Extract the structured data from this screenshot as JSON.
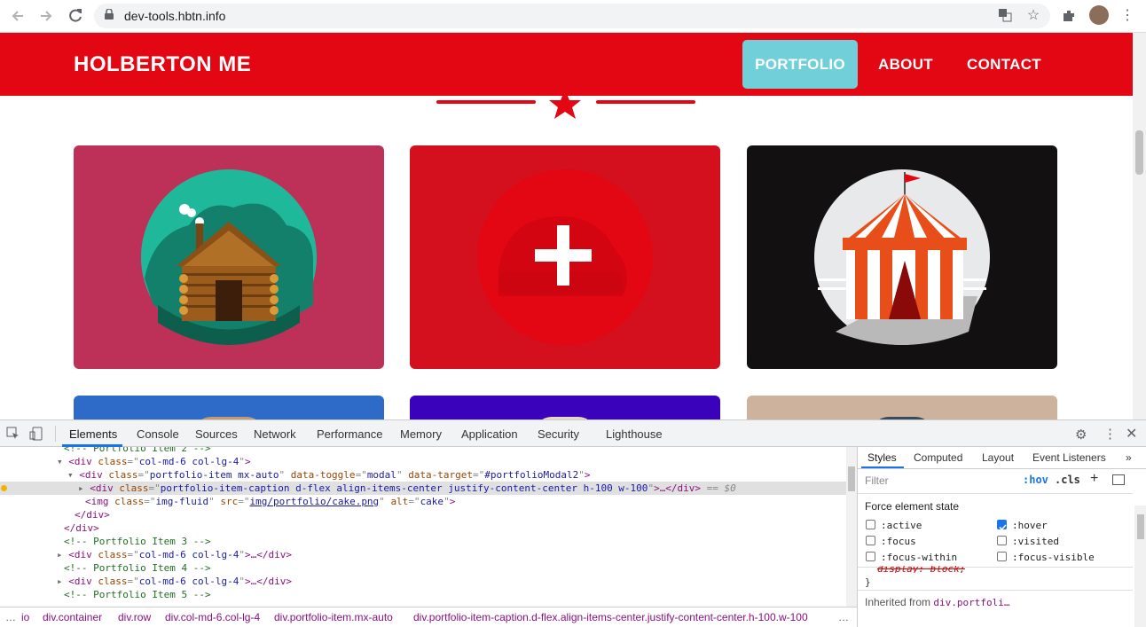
{
  "browser": {
    "url": "dev-tools.hbtn.info"
  },
  "site": {
    "brand": "HOLBERTON ME",
    "nav": [
      {
        "label": "PORTFOLIO",
        "active": true
      },
      {
        "label": "ABOUT",
        "active": false
      },
      {
        "label": "CONTACT",
        "active": false
      }
    ],
    "cards_row1": [
      "cabin",
      "cake",
      "circus"
    ],
    "colors": {
      "navbar": "#e30613",
      "active_nav": "#70cfd8",
      "card1": "#bd3159",
      "card2": "#e30613",
      "card3": "#131011",
      "card4": "#2e6bc8",
      "card5": "#3a02bb",
      "card6": "#cdb29d"
    }
  },
  "devtools": {
    "tabs": [
      "Elements",
      "Console",
      "Sources",
      "Network",
      "Performance",
      "Memory",
      "Application",
      "Security",
      "Lighthouse"
    ],
    "dom_lines": [
      {
        "indent": 0,
        "text": "<!-- Portfolio Item 2 -->",
        "kind": "comment"
      },
      {
        "indent": 0,
        "caret": "▾",
        "tag": "div",
        "attrs": [
          [
            "class",
            "col-md-6 col-lg-4"
          ]
        ],
        "close": ""
      },
      {
        "indent": 1,
        "caret": "▾",
        "tag": "div",
        "attrs": [
          [
            "class",
            "portfolio-item mx-auto"
          ],
          [
            "data-toggle",
            "modal"
          ],
          [
            "data-target",
            "#portfolioModal2"
          ]
        ],
        "close": ""
      },
      {
        "indent": 2,
        "caret": "▸",
        "tag": "div",
        "attrs": [
          [
            "class",
            "portfolio-item-caption d-flex align-items-center justify-content-center h-100 w-100"
          ]
        ],
        "close": "…</div>",
        "suffix": " == $0",
        "selected": true
      },
      {
        "indent": 2,
        "tag": "img",
        "attrs": [
          [
            "class",
            "img-fluid"
          ],
          [
            "src",
            "img/portfolio/cake.png"
          ],
          [
            "alt",
            "cake"
          ]
        ],
        "close": ""
      },
      {
        "indent": 1,
        "kind": "end",
        "text": "</div>"
      },
      {
        "indent": 0,
        "kind": "end",
        "text": "</div>"
      },
      {
        "indent": 0,
        "text": "<!-- Portfolio Item 3 -->",
        "kind": "comment"
      },
      {
        "indent": 0,
        "caret": "▸",
        "tag": "div",
        "attrs": [
          [
            "class",
            "col-md-6 col-lg-4"
          ]
        ],
        "close": "…</div>"
      },
      {
        "indent": 0,
        "text": "<!-- Portfolio Item 4 -->",
        "kind": "comment"
      },
      {
        "indent": 0,
        "caret": "▸",
        "tag": "div",
        "attrs": [
          [
            "class",
            "col-md-6 col-lg-4"
          ]
        ],
        "close": "…</div>"
      },
      {
        "indent": 0,
        "text": "<!-- Portfolio Item 5 -->",
        "kind": "comment"
      }
    ],
    "breadcrumbs": [
      "…",
      "io",
      "div.container",
      "div.row",
      "div.col-md-6.col-lg-4",
      "div.portfolio-item.mx-auto",
      "div.portfolio-item-caption.d-flex.align-items-center.justify-content-center.h-100.w-100",
      "…"
    ],
    "styles": {
      "tabs": [
        "Styles",
        "Computed",
        "Layout",
        "Event Listeners"
      ],
      "filter_placeholder": "Filter",
      "hov": ":hov",
      "cls": ".cls",
      "force_title": "Force element state",
      "states": [
        {
          "label": ":active",
          "checked": false
        },
        {
          "label": ":hover",
          "checked": true
        },
        {
          "label": ":focus",
          "checked": false
        },
        {
          "label": ":visited",
          "checked": false
        },
        {
          "label": ":focus-within",
          "checked": false
        },
        {
          "label": ":focus-visible",
          "checked": false
        }
      ],
      "rule_line": "display: block;",
      "brace": "}",
      "inherited_label": "Inherited from",
      "inherited_from": "div.portfoli…"
    }
  }
}
